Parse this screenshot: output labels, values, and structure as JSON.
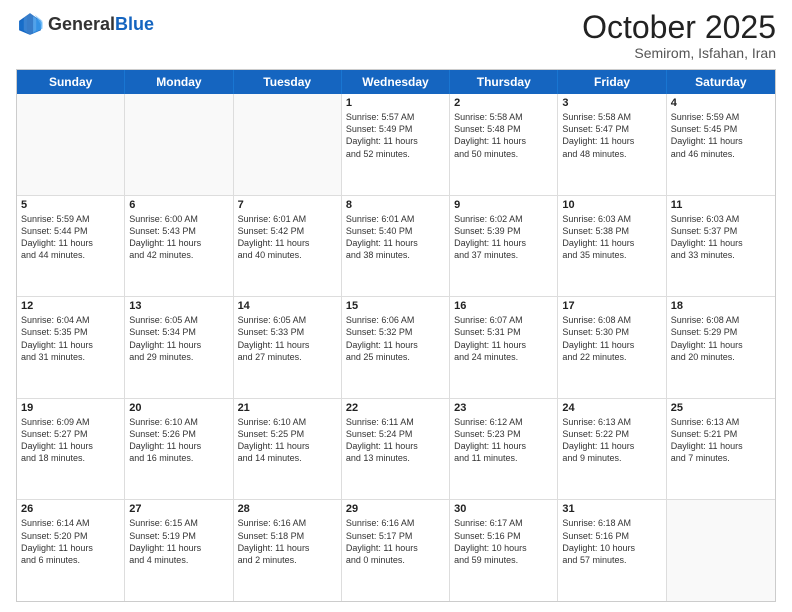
{
  "header": {
    "logo_general": "General",
    "logo_blue": "Blue",
    "month_title": "October 2025",
    "subtitle": "Semirom, Isfahan, Iran"
  },
  "weekdays": [
    "Sunday",
    "Monday",
    "Tuesday",
    "Wednesday",
    "Thursday",
    "Friday",
    "Saturday"
  ],
  "rows": [
    [
      {
        "day": "",
        "lines": []
      },
      {
        "day": "",
        "lines": []
      },
      {
        "day": "",
        "lines": []
      },
      {
        "day": "1",
        "lines": [
          "Sunrise: 5:57 AM",
          "Sunset: 5:49 PM",
          "Daylight: 11 hours",
          "and 52 minutes."
        ]
      },
      {
        "day": "2",
        "lines": [
          "Sunrise: 5:58 AM",
          "Sunset: 5:48 PM",
          "Daylight: 11 hours",
          "and 50 minutes."
        ]
      },
      {
        "day": "3",
        "lines": [
          "Sunrise: 5:58 AM",
          "Sunset: 5:47 PM",
          "Daylight: 11 hours",
          "and 48 minutes."
        ]
      },
      {
        "day": "4",
        "lines": [
          "Sunrise: 5:59 AM",
          "Sunset: 5:45 PM",
          "Daylight: 11 hours",
          "and 46 minutes."
        ]
      }
    ],
    [
      {
        "day": "5",
        "lines": [
          "Sunrise: 5:59 AM",
          "Sunset: 5:44 PM",
          "Daylight: 11 hours",
          "and 44 minutes."
        ]
      },
      {
        "day": "6",
        "lines": [
          "Sunrise: 6:00 AM",
          "Sunset: 5:43 PM",
          "Daylight: 11 hours",
          "and 42 minutes."
        ]
      },
      {
        "day": "7",
        "lines": [
          "Sunrise: 6:01 AM",
          "Sunset: 5:42 PM",
          "Daylight: 11 hours",
          "and 40 minutes."
        ]
      },
      {
        "day": "8",
        "lines": [
          "Sunrise: 6:01 AM",
          "Sunset: 5:40 PM",
          "Daylight: 11 hours",
          "and 38 minutes."
        ]
      },
      {
        "day": "9",
        "lines": [
          "Sunrise: 6:02 AM",
          "Sunset: 5:39 PM",
          "Daylight: 11 hours",
          "and 37 minutes."
        ]
      },
      {
        "day": "10",
        "lines": [
          "Sunrise: 6:03 AM",
          "Sunset: 5:38 PM",
          "Daylight: 11 hours",
          "and 35 minutes."
        ]
      },
      {
        "day": "11",
        "lines": [
          "Sunrise: 6:03 AM",
          "Sunset: 5:37 PM",
          "Daylight: 11 hours",
          "and 33 minutes."
        ]
      }
    ],
    [
      {
        "day": "12",
        "lines": [
          "Sunrise: 6:04 AM",
          "Sunset: 5:35 PM",
          "Daylight: 11 hours",
          "and 31 minutes."
        ]
      },
      {
        "day": "13",
        "lines": [
          "Sunrise: 6:05 AM",
          "Sunset: 5:34 PM",
          "Daylight: 11 hours",
          "and 29 minutes."
        ]
      },
      {
        "day": "14",
        "lines": [
          "Sunrise: 6:05 AM",
          "Sunset: 5:33 PM",
          "Daylight: 11 hours",
          "and 27 minutes."
        ]
      },
      {
        "day": "15",
        "lines": [
          "Sunrise: 6:06 AM",
          "Sunset: 5:32 PM",
          "Daylight: 11 hours",
          "and 25 minutes."
        ]
      },
      {
        "day": "16",
        "lines": [
          "Sunrise: 6:07 AM",
          "Sunset: 5:31 PM",
          "Daylight: 11 hours",
          "and 24 minutes."
        ]
      },
      {
        "day": "17",
        "lines": [
          "Sunrise: 6:08 AM",
          "Sunset: 5:30 PM",
          "Daylight: 11 hours",
          "and 22 minutes."
        ]
      },
      {
        "day": "18",
        "lines": [
          "Sunrise: 6:08 AM",
          "Sunset: 5:29 PM",
          "Daylight: 11 hours",
          "and 20 minutes."
        ]
      }
    ],
    [
      {
        "day": "19",
        "lines": [
          "Sunrise: 6:09 AM",
          "Sunset: 5:27 PM",
          "Daylight: 11 hours",
          "and 18 minutes."
        ]
      },
      {
        "day": "20",
        "lines": [
          "Sunrise: 6:10 AM",
          "Sunset: 5:26 PM",
          "Daylight: 11 hours",
          "and 16 minutes."
        ]
      },
      {
        "day": "21",
        "lines": [
          "Sunrise: 6:10 AM",
          "Sunset: 5:25 PM",
          "Daylight: 11 hours",
          "and 14 minutes."
        ]
      },
      {
        "day": "22",
        "lines": [
          "Sunrise: 6:11 AM",
          "Sunset: 5:24 PM",
          "Daylight: 11 hours",
          "and 13 minutes."
        ]
      },
      {
        "day": "23",
        "lines": [
          "Sunrise: 6:12 AM",
          "Sunset: 5:23 PM",
          "Daylight: 11 hours",
          "and 11 minutes."
        ]
      },
      {
        "day": "24",
        "lines": [
          "Sunrise: 6:13 AM",
          "Sunset: 5:22 PM",
          "Daylight: 11 hours",
          "and 9 minutes."
        ]
      },
      {
        "day": "25",
        "lines": [
          "Sunrise: 6:13 AM",
          "Sunset: 5:21 PM",
          "Daylight: 11 hours",
          "and 7 minutes."
        ]
      }
    ],
    [
      {
        "day": "26",
        "lines": [
          "Sunrise: 6:14 AM",
          "Sunset: 5:20 PM",
          "Daylight: 11 hours",
          "and 6 minutes."
        ]
      },
      {
        "day": "27",
        "lines": [
          "Sunrise: 6:15 AM",
          "Sunset: 5:19 PM",
          "Daylight: 11 hours",
          "and 4 minutes."
        ]
      },
      {
        "day": "28",
        "lines": [
          "Sunrise: 6:16 AM",
          "Sunset: 5:18 PM",
          "Daylight: 11 hours",
          "and 2 minutes."
        ]
      },
      {
        "day": "29",
        "lines": [
          "Sunrise: 6:16 AM",
          "Sunset: 5:17 PM",
          "Daylight: 11 hours",
          "and 0 minutes."
        ]
      },
      {
        "day": "30",
        "lines": [
          "Sunrise: 6:17 AM",
          "Sunset: 5:16 PM",
          "Daylight: 10 hours",
          "and 59 minutes."
        ]
      },
      {
        "day": "31",
        "lines": [
          "Sunrise: 6:18 AM",
          "Sunset: 5:16 PM",
          "Daylight: 10 hours",
          "and 57 minutes."
        ]
      },
      {
        "day": "",
        "lines": []
      }
    ]
  ]
}
